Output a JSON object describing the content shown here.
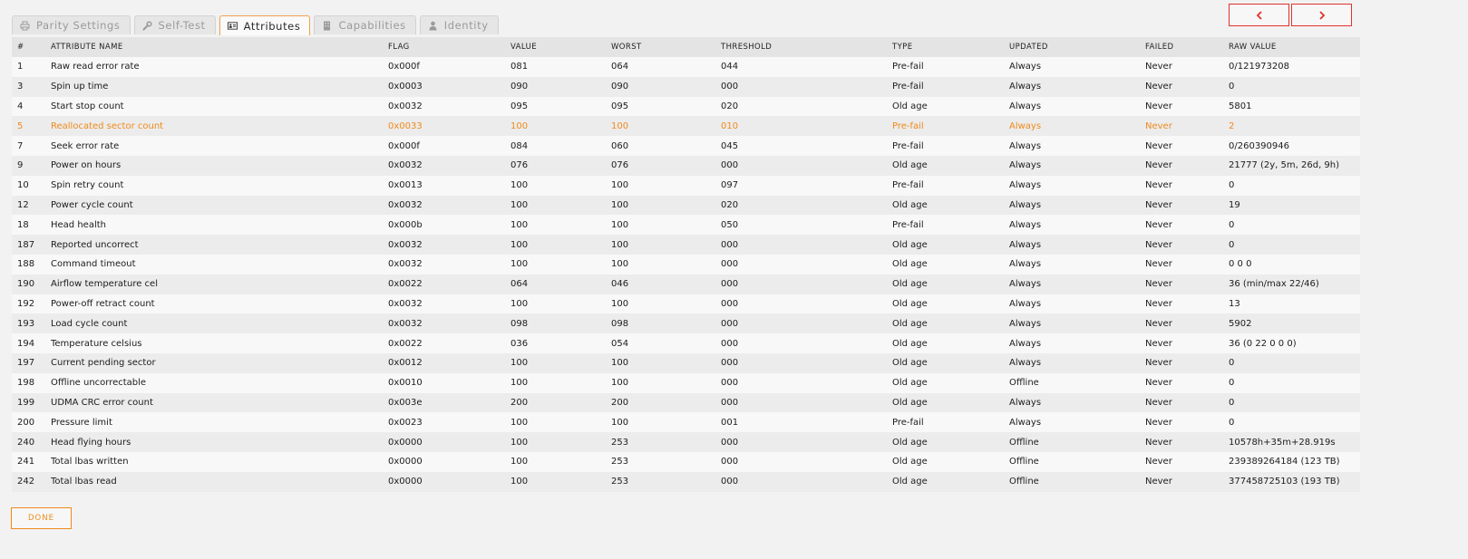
{
  "tabs": [
    {
      "label": "Parity Settings",
      "icon": "printer-icon",
      "active": false
    },
    {
      "label": "Self-Test",
      "icon": "wrench-icon",
      "active": false
    },
    {
      "label": "Attributes",
      "icon": "id-card-icon",
      "active": true
    },
    {
      "label": "Capabilities",
      "icon": "building-icon",
      "active": false
    },
    {
      "label": "Identity",
      "icon": "user-icon",
      "active": false
    }
  ],
  "nav": {
    "prev_icon": "chevron-left-icon",
    "next_icon": "chevron-right-icon"
  },
  "colors": {
    "accent": "#f08a1c",
    "nav_border": "#e0322e",
    "warning": "#f08a1c"
  },
  "table": {
    "headers": [
      "#",
      "ATTRIBUTE NAME",
      "FLAG",
      "VALUE",
      "WORST",
      "THRESHOLD",
      "TYPE",
      "UPDATED",
      "FAILED",
      "RAW VALUE"
    ],
    "rows": [
      {
        "cells": [
          "1",
          "Raw read error rate",
          "0x000f",
          "081",
          "064",
          "044",
          "Pre-fail",
          "Always",
          "Never",
          "0/121973208"
        ],
        "warning": false
      },
      {
        "cells": [
          "3",
          "Spin up time",
          "0x0003",
          "090",
          "090",
          "000",
          "Pre-fail",
          "Always",
          "Never",
          "0"
        ],
        "warning": false
      },
      {
        "cells": [
          "4",
          "Start stop count",
          "0x0032",
          "095",
          "095",
          "020",
          "Old age",
          "Always",
          "Never",
          "5801"
        ],
        "warning": false
      },
      {
        "cells": [
          "5",
          "Reallocated sector count",
          "0x0033",
          "100",
          "100",
          "010",
          "Pre-fail",
          "Always",
          "Never",
          "2"
        ],
        "warning": true
      },
      {
        "cells": [
          "7",
          "Seek error rate",
          "0x000f",
          "084",
          "060",
          "045",
          "Pre-fail",
          "Always",
          "Never",
          "0/260390946"
        ],
        "warning": false
      },
      {
        "cells": [
          "9",
          "Power on hours",
          "0x0032",
          "076",
          "076",
          "000",
          "Old age",
          "Always",
          "Never",
          "21777 (2y, 5m, 26d, 9h)"
        ],
        "warning": false
      },
      {
        "cells": [
          "10",
          "Spin retry count",
          "0x0013",
          "100",
          "100",
          "097",
          "Pre-fail",
          "Always",
          "Never",
          "0"
        ],
        "warning": false
      },
      {
        "cells": [
          "12",
          "Power cycle count",
          "0x0032",
          "100",
          "100",
          "020",
          "Old age",
          "Always",
          "Never",
          "19"
        ],
        "warning": false
      },
      {
        "cells": [
          "18",
          "Head health",
          "0x000b",
          "100",
          "100",
          "050",
          "Pre-fail",
          "Always",
          "Never",
          "0"
        ],
        "warning": false
      },
      {
        "cells": [
          "187",
          "Reported uncorrect",
          "0x0032",
          "100",
          "100",
          "000",
          "Old age",
          "Always",
          "Never",
          "0"
        ],
        "warning": false
      },
      {
        "cells": [
          "188",
          "Command timeout",
          "0x0032",
          "100",
          "100",
          "000",
          "Old age",
          "Always",
          "Never",
          "0 0 0"
        ],
        "warning": false
      },
      {
        "cells": [
          "190",
          "Airflow temperature cel",
          "0x0022",
          "064",
          "046",
          "000",
          "Old age",
          "Always",
          "Never",
          "36 (min/max 22/46)"
        ],
        "warning": false
      },
      {
        "cells": [
          "192",
          "Power-off retract count",
          "0x0032",
          "100",
          "100",
          "000",
          "Old age",
          "Always",
          "Never",
          "13"
        ],
        "warning": false
      },
      {
        "cells": [
          "193",
          "Load cycle count",
          "0x0032",
          "098",
          "098",
          "000",
          "Old age",
          "Always",
          "Never",
          "5902"
        ],
        "warning": false
      },
      {
        "cells": [
          "194",
          "Temperature celsius",
          "0x0022",
          "036",
          "054",
          "000",
          "Old age",
          "Always",
          "Never",
          "36 (0 22 0 0 0)"
        ],
        "warning": false
      },
      {
        "cells": [
          "197",
          "Current pending sector",
          "0x0012",
          "100",
          "100",
          "000",
          "Old age",
          "Always",
          "Never",
          "0"
        ],
        "warning": false
      },
      {
        "cells": [
          "198",
          "Offline uncorrectable",
          "0x0010",
          "100",
          "100",
          "000",
          "Old age",
          "Offline",
          "Never",
          "0"
        ],
        "warning": false
      },
      {
        "cells": [
          "199",
          "UDMA CRC error count",
          "0x003e",
          "200",
          "200",
          "000",
          "Old age",
          "Always",
          "Never",
          "0"
        ],
        "warning": false
      },
      {
        "cells": [
          "200",
          "Pressure limit",
          "0x0023",
          "100",
          "100",
          "001",
          "Pre-fail",
          "Always",
          "Never",
          "0"
        ],
        "warning": false
      },
      {
        "cells": [
          "240",
          "Head flying hours",
          "0x0000",
          "100",
          "253",
          "000",
          "Old age",
          "Offline",
          "Never",
          "10578h+35m+28.919s"
        ],
        "warning": false
      },
      {
        "cells": [
          "241",
          "Total lbas written",
          "0x0000",
          "100",
          "253",
          "000",
          "Old age",
          "Offline",
          "Never",
          "239389264184 (123 TB)"
        ],
        "warning": false
      },
      {
        "cells": [
          "242",
          "Total lbas read",
          "0x0000",
          "100",
          "253",
          "000",
          "Old age",
          "Offline",
          "Never",
          "377458725103 (193 TB)"
        ],
        "warning": false
      }
    ]
  },
  "done_label": "DONE"
}
